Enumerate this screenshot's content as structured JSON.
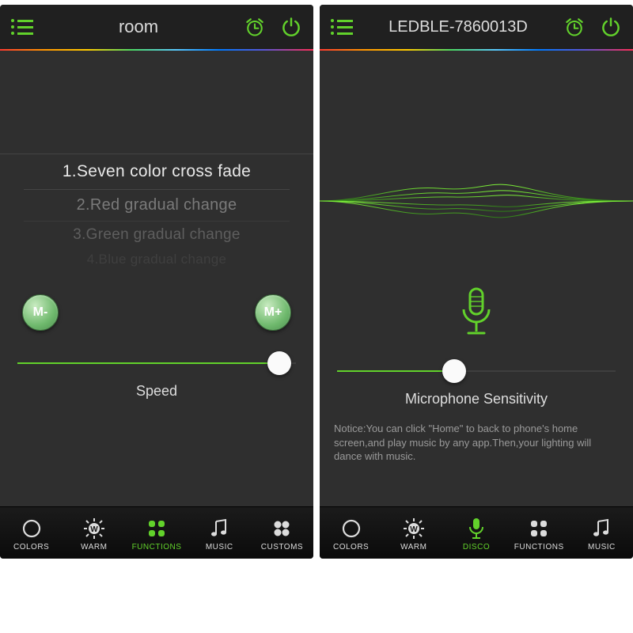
{
  "accent": "#62d22b",
  "left": {
    "title": "room",
    "picker": {
      "rows": [
        "1.Seven color cross fade",
        "2.Red  gradual change",
        "3.Green gradual change",
        "4.Blue gradual change"
      ]
    },
    "m_minus": "M-",
    "m_plus": "M+",
    "slider": {
      "label": "Speed",
      "value_pct": 94
    },
    "nav": {
      "items": [
        {
          "label": "COLORS",
          "icon": "circle",
          "active": false
        },
        {
          "label": "WARM",
          "icon": "warm",
          "active": false
        },
        {
          "label": "FUNCTIONS",
          "icon": "quad",
          "active": true
        },
        {
          "label": "MUSIC",
          "icon": "note",
          "active": false
        },
        {
          "label": "CUSTOMS",
          "icon": "quad",
          "active": false
        }
      ],
      "t0": "COLORS",
      "t1": "WARM",
      "t2": "FUNCTIONS",
      "t3": "MUSIC",
      "t4": "CUSTOMS"
    }
  },
  "right": {
    "title": "LEDBLE-7860013D",
    "slider": {
      "label": "Microphone Sensitivity",
      "value_pct": 42
    },
    "notice": "Notice:You can click \"Home\" to back to phone's home screen,and play music by any app.Then,your lighting will dance with music.",
    "nav": {
      "items": [
        {
          "label": "COLORS",
          "icon": "circle",
          "active": false
        },
        {
          "label": "WARM",
          "icon": "warm",
          "active": false
        },
        {
          "label": "DISCO",
          "icon": "mic",
          "active": true
        },
        {
          "label": "FUNCTIONS",
          "icon": "quad",
          "active": false
        },
        {
          "label": "MUSIC",
          "icon": "note",
          "active": false
        }
      ],
      "t0": "COLORS",
      "t1": "WARM",
      "t2": "DISCO",
      "t3": "FUNCTIONS",
      "t4": "MUSIC"
    }
  }
}
